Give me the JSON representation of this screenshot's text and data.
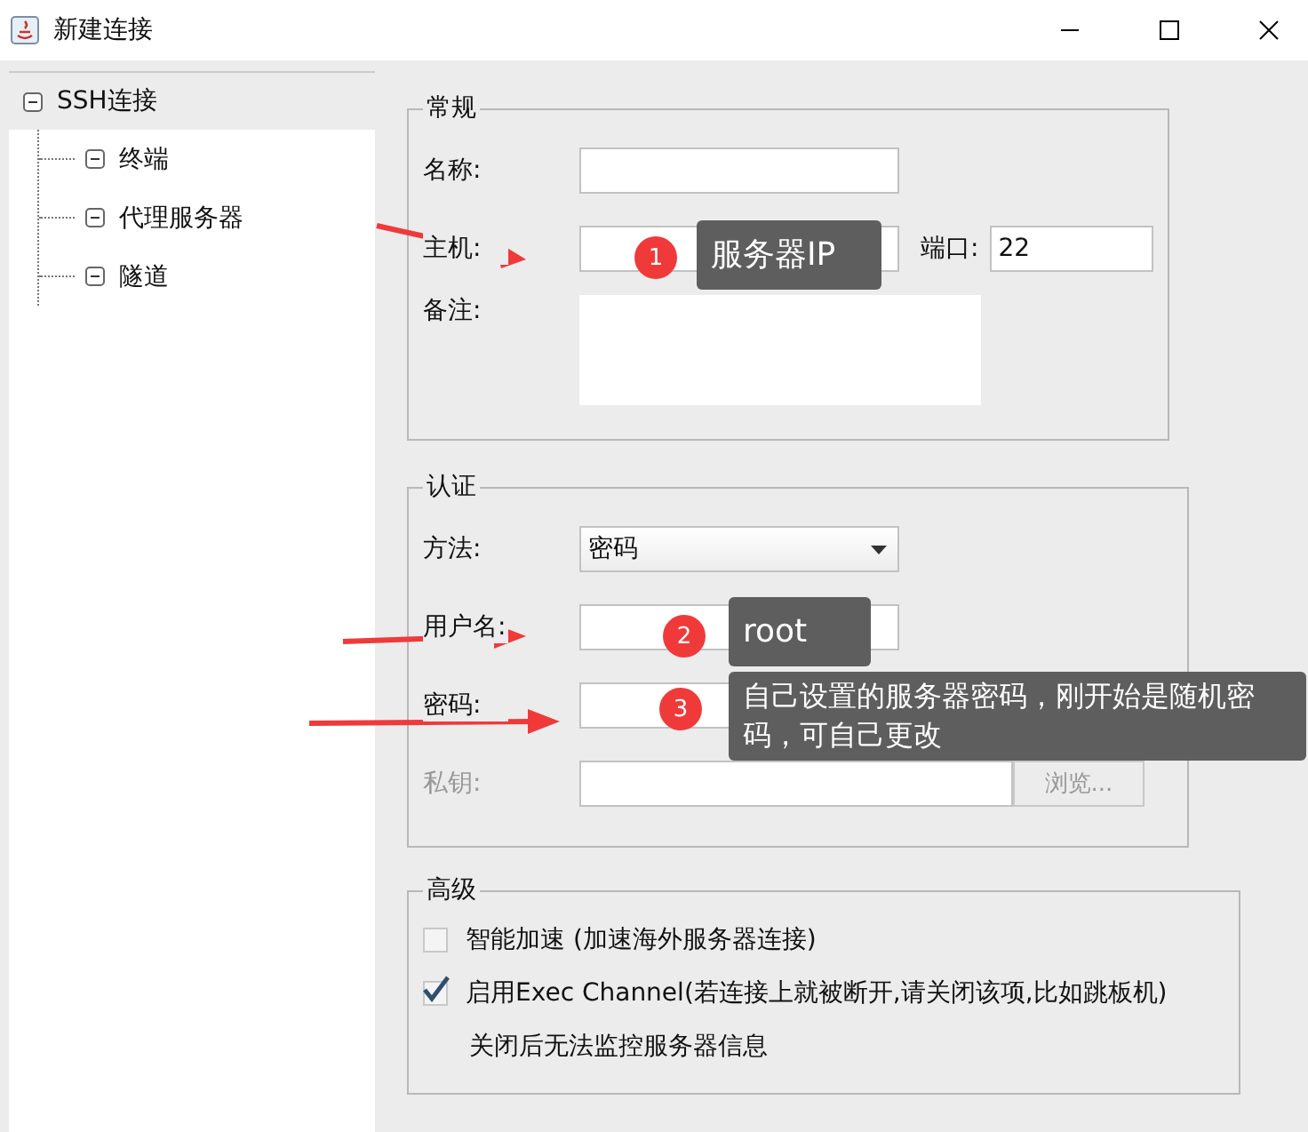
{
  "window": {
    "title": "新建连接"
  },
  "tree": [
    {
      "label": "SSH连接",
      "expanded": true,
      "selected": true,
      "children": [
        {
          "label": "终端",
          "expanded": true,
          "selected": false
        },
        {
          "label": "代理服务器",
          "expanded": true,
          "selected": false
        },
        {
          "label": "隧道",
          "expanded": true,
          "selected": false
        }
      ]
    }
  ],
  "general": {
    "title": "常规",
    "name_label": "名称:",
    "host_label": "主机:",
    "port_label": "端口:",
    "port_value": "22",
    "note_label": "备注:"
  },
  "auth": {
    "title": "认证",
    "method_label": "方法:",
    "method_value": "密码",
    "user_label": "用户名:",
    "password_label": "密码:",
    "key_label": "私钥:",
    "key_disabled": true,
    "browse_button": "浏览..."
  },
  "advanced": {
    "title": "高级",
    "options": [
      {
        "label": "智能加速 (加速海外服务器连接)",
        "checked": false
      },
      {
        "label": "启用Exec Channel(若连接上就被断开,请关闭该项,比如跳板机)",
        "checked": true
      }
    ],
    "note": "关闭后无法监控服务器信息"
  },
  "annotations": [
    {
      "number": "1",
      "text": "服务器IP"
    },
    {
      "number": "2",
      "text": "root"
    },
    {
      "number": "3",
      "text": "自己设置的服务器密码，刚开始是随机密码，可自己更改"
    }
  ]
}
